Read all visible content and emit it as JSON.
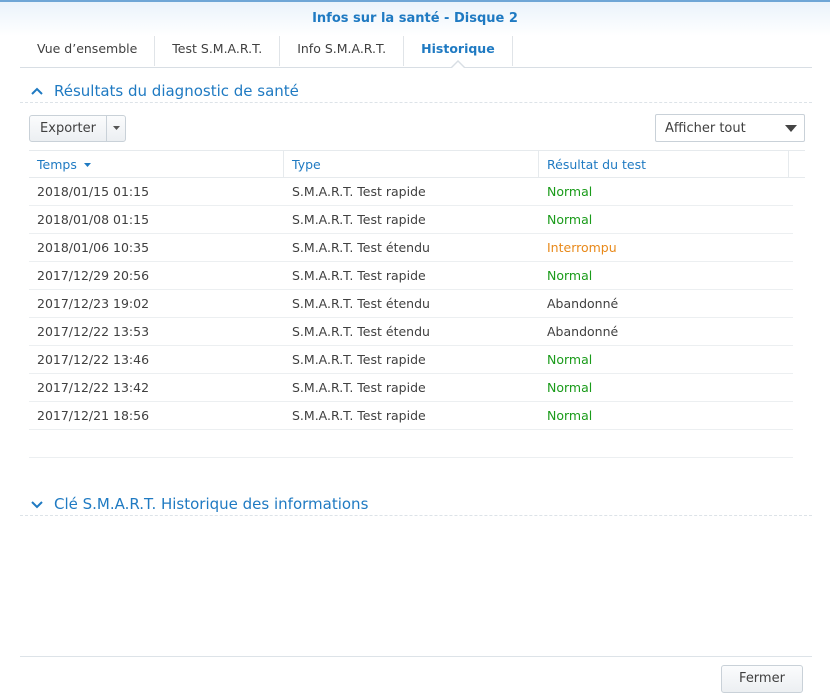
{
  "window": {
    "title": "Infos sur la santé - Disque 2"
  },
  "tabs": [
    {
      "label": "Vue d’ensemble",
      "active": false
    },
    {
      "label": "Test S.M.A.R.T.",
      "active": false
    },
    {
      "label": "Info S.M.A.R.T.",
      "active": false
    },
    {
      "label": "Historique",
      "active": true
    }
  ],
  "section1": {
    "title": "Résultats du diagnostic de santé",
    "icon": "chevron-up-icon"
  },
  "toolbar": {
    "export_label": "Exporter",
    "filter_value": "Afficher tout"
  },
  "grid": {
    "columns": [
      "Temps",
      "Type",
      "Résultat du test"
    ],
    "rows": [
      {
        "time": "2018/01/15 01:15",
        "type": "S.M.A.R.T. Test rapide",
        "result": "Normal",
        "status": "normal"
      },
      {
        "time": "2018/01/08 01:15",
        "type": "S.M.A.R.T. Test rapide",
        "result": "Normal",
        "status": "normal"
      },
      {
        "time": "2018/01/06 10:35",
        "type": "S.M.A.R.T. Test étendu",
        "result": "Interrompu",
        "status": "interrompu"
      },
      {
        "time": "2017/12/29 20:56",
        "type": "S.M.A.R.T. Test rapide",
        "result": "Normal",
        "status": "normal"
      },
      {
        "time": "2017/12/23 19:02",
        "type": "S.M.A.R.T. Test étendu",
        "result": "Abandonné",
        "status": "abandonne"
      },
      {
        "time": "2017/12/22 13:53",
        "type": "S.M.A.R.T. Test étendu",
        "result": "Abandonné",
        "status": "abandonne"
      },
      {
        "time": "2017/12/22 13:46",
        "type": "S.M.A.R.T. Test rapide",
        "result": "Normal",
        "status": "normal"
      },
      {
        "time": "2017/12/22 13:42",
        "type": "S.M.A.R.T. Test rapide",
        "result": "Normal",
        "status": "normal"
      },
      {
        "time": "2017/12/21 18:56",
        "type": "S.M.A.R.T. Test rapide",
        "result": "Normal",
        "status": "normal"
      }
    ]
  },
  "section2": {
    "title": "Clé S.M.A.R.T. Historique des informations",
    "icon": "chevron-down-icon"
  },
  "footer": {
    "close_label": "Fermer"
  },
  "colors": {
    "accent": "#1f7ac2",
    "normal": "#1a9b1a",
    "interrompu": "#e8891a"
  }
}
